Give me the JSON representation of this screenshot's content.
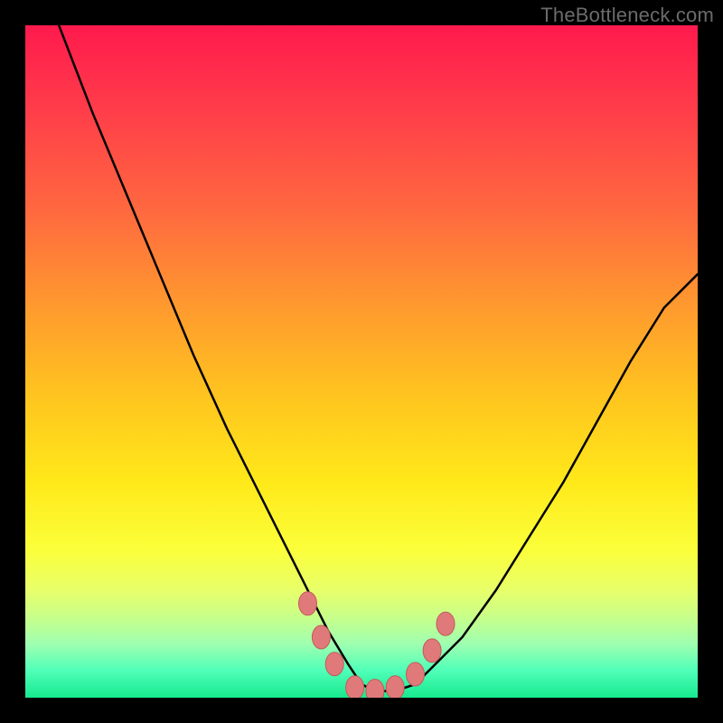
{
  "watermark": {
    "text": "TheBottleneck.com"
  },
  "colors": {
    "frame": "#000000",
    "gradient_top": "#ff1a4d",
    "gradient_mid": "#ffe91a",
    "gradient_bottom": "#17e98f",
    "curve_stroke": "#000000",
    "marker_fill": "#e07a7a",
    "marker_stroke": "#c25a5a"
  },
  "chart_data": {
    "type": "line",
    "title": "",
    "subtitle": "",
    "xlabel": "",
    "ylabel": "",
    "xlim": [
      0,
      100
    ],
    "ylim": [
      0,
      100
    ],
    "grid": false,
    "legend": false,
    "series": [
      {
        "name": "curve",
        "x": [
          5,
          10,
          15,
          20,
          25,
          30,
          35,
          40,
          42,
          45,
          48,
          50,
          52,
          55,
          58,
          60,
          65,
          70,
          75,
          80,
          85,
          90,
          95,
          100
        ],
        "y": [
          100,
          87,
          75,
          63,
          51,
          40,
          30,
          20,
          16,
          10,
          5,
          2,
          1,
          1,
          2,
          4,
          9,
          16,
          24,
          32,
          41,
          50,
          58,
          63
        ]
      }
    ],
    "markers": [
      {
        "x": 42.0,
        "y": 14.0
      },
      {
        "x": 44.0,
        "y": 9.0
      },
      {
        "x": 46.0,
        "y": 5.0
      },
      {
        "x": 49.0,
        "y": 1.5
      },
      {
        "x": 52.0,
        "y": 1.0
      },
      {
        "x": 55.0,
        "y": 1.5
      },
      {
        "x": 58.0,
        "y": 3.5
      },
      {
        "x": 60.5,
        "y": 7.0
      },
      {
        "x": 62.5,
        "y": 11.0
      }
    ],
    "annotations": []
  }
}
